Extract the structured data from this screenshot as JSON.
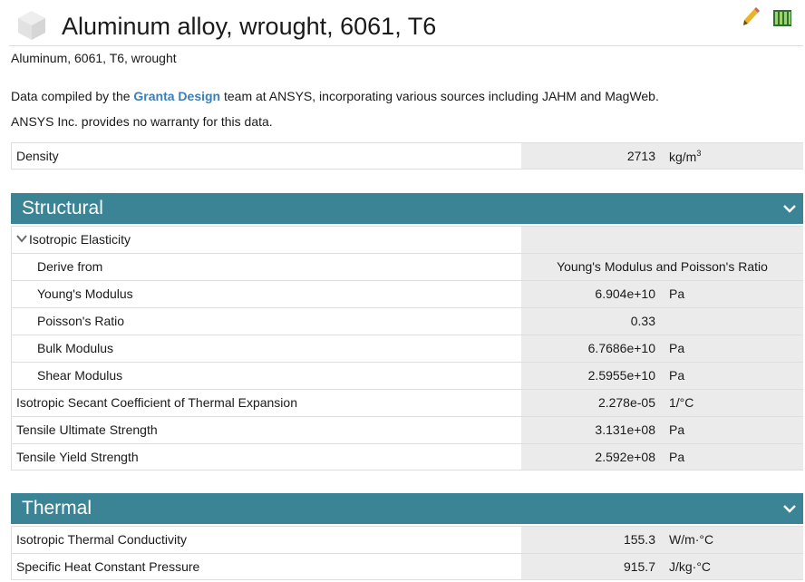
{
  "header": {
    "title": "Aluminum alloy, wrought, 6061, T6",
    "icons": [
      "cube-icon",
      "pencil-icon",
      "chart-icon"
    ],
    "subtitle": "Aluminum, 6061, T6, wrought"
  },
  "credit": {
    "prefix": "Data compiled by the ",
    "link": "Granta Design",
    "suffix": " team at ANSYS, incorporating various sources including JAHM and MagWeb.",
    "warranty": "ANSYS Inc. provides no warranty for this data."
  },
  "density": {
    "name": "Density",
    "value": "2713",
    "unit": "kg/m",
    "unit_sup": "3"
  },
  "structural": {
    "title": "Structural",
    "group": "Isotropic Elasticity",
    "rows": [
      {
        "name": "Derive from",
        "value": "Young's Modulus and Poisson's Ratio",
        "unit": ""
      },
      {
        "name": "Young's Modulus",
        "value": "6.904e+10",
        "unit": "Pa"
      },
      {
        "name": "Poisson's Ratio",
        "value": "0.33",
        "unit": ""
      },
      {
        "name": "Bulk Modulus",
        "value": "6.7686e+10",
        "unit": "Pa"
      },
      {
        "name": "Shear Modulus",
        "value": "2.5955e+10",
        "unit": "Pa"
      },
      {
        "name": "Isotropic Secant Coefficient of Thermal Expansion",
        "value": "2.278e-05",
        "unit": "1/°C"
      },
      {
        "name": "Tensile Ultimate Strength",
        "value": "3.131e+08",
        "unit": "Pa"
      },
      {
        "name": "Tensile Yield Strength",
        "value": "2.592e+08",
        "unit": "Pa"
      }
    ]
  },
  "thermal": {
    "title": "Thermal",
    "rows": [
      {
        "name": "Isotropic Thermal Conductivity",
        "value": "155.3",
        "unit": "W/m·°C"
      },
      {
        "name": "Specific Heat Constant Pressure",
        "value": "915.7",
        "unit": "J/kg·°C"
      }
    ]
  },
  "colors": {
    "band": "#3b8496",
    "link": "#3b7fb8",
    "value_cell": "#ebebeb"
  }
}
